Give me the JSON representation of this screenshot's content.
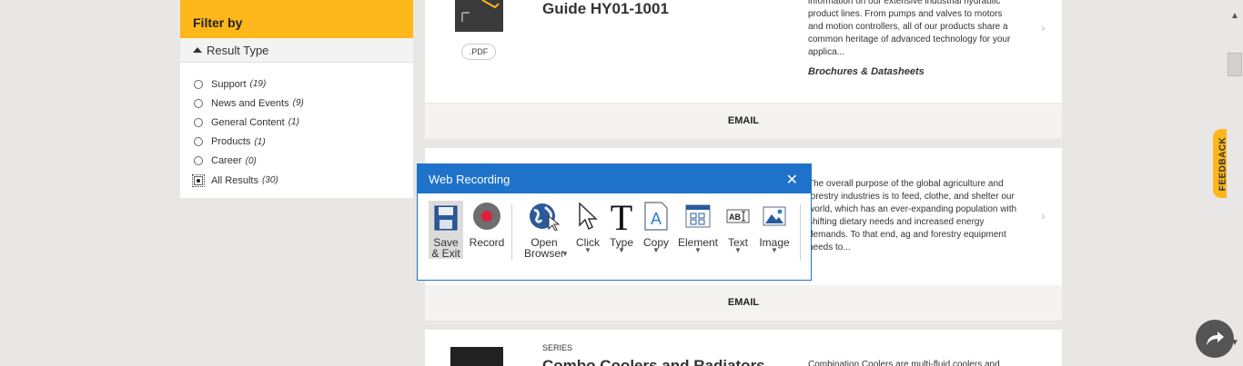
{
  "filter": {
    "header": "Filter by",
    "result_type_label": "Result Type",
    "options": [
      {
        "label": "Support",
        "count": "(19)",
        "selected": false
      },
      {
        "label": "News and Events",
        "count": "(9)",
        "selected": false
      },
      {
        "label": "General Content",
        "count": "(1)",
        "selected": false
      },
      {
        "label": "Products",
        "count": "(1)",
        "selected": false
      },
      {
        "label": "Career",
        "count": "(0)",
        "selected": false
      },
      {
        "label": "All Results",
        "count": "(30)",
        "selected": true
      }
    ]
  },
  "results": [
    {
      "title": "Guide HY01-1001",
      "badge": ".PDF",
      "description": "information on our extensive industrial hydraulic product lines. From pumps and valves to motors and motion controllers, all of our products share a common heritage of advanced technology for your applica...",
      "category": "Brochures & Datasheets",
      "email_label": "EMAIL"
    },
    {
      "description": "The overall purpose of the global agriculture and forestry industries is to feed, clothe, and shelter our world, which has an ever-expanding population with shifting dietary needs and increased energy demands. To that end, ag and forestry equipment needs to...",
      "email_label": "EMAIL"
    },
    {
      "series_label": "SERIES",
      "title": "Combo Coolers and Radiators",
      "description": "Combination Coolers are multi-fluid coolers and"
    }
  ],
  "feedback_label": "FEEDBACK",
  "dialog": {
    "title": "Web Recording",
    "tools": {
      "save": "Save & Exit",
      "record": "Record",
      "open_browser": "Open Browser",
      "click": "Click",
      "type": "Type",
      "copy": "Copy",
      "element": "Element",
      "text": "Text",
      "image": "Image"
    }
  },
  "colors": {
    "accent_yellow": "#fdb71a",
    "dialog_blue": "#1e72c9",
    "background": "#e8e7e5"
  }
}
